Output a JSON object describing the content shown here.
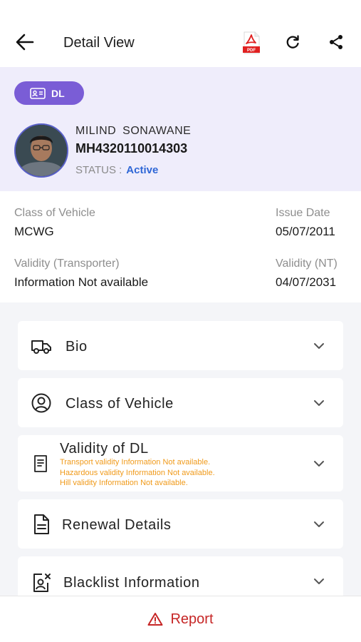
{
  "header": {
    "title": "Detail View",
    "pdf_label": "PDF"
  },
  "profile": {
    "badge_label": "DL",
    "name": "MILIND  SONAWANE",
    "dl_number": "MH4320110014303",
    "status_label": "STATUS :",
    "status_value": "Active"
  },
  "info": {
    "class_of_vehicle_label": "Class of Vehicle",
    "class_of_vehicle_value": "MCWG",
    "issue_date_label": "Issue Date",
    "issue_date_value": "05/07/2011",
    "validity_transporter_label": "Validity (Transporter)",
    "validity_transporter_value": "Information Not available",
    "validity_nt_label": "Validity (NT)",
    "validity_nt_value": "04/07/2031"
  },
  "sections": [
    {
      "title": "Bio",
      "icon": "truck-icon"
    },
    {
      "title": "Class of Vehicle",
      "icon": "user-circle-icon"
    },
    {
      "title": "Validity of DL",
      "icon": "document-icon",
      "warnings": [
        "Transport validity Information Not available.",
        "Hazardous validity Information Not available.",
        "Hill validity Information Not available."
      ]
    },
    {
      "title": "Renewal Details",
      "icon": "file-text-icon"
    },
    {
      "title": "Blacklist Information",
      "icon": "blacklist-icon"
    }
  ],
  "footer": {
    "report_label": "Report"
  },
  "colors": {
    "accent": "#7a5dd6",
    "status_active": "#2f67d6",
    "warning": "#f09a1a",
    "report": "#c62626"
  }
}
